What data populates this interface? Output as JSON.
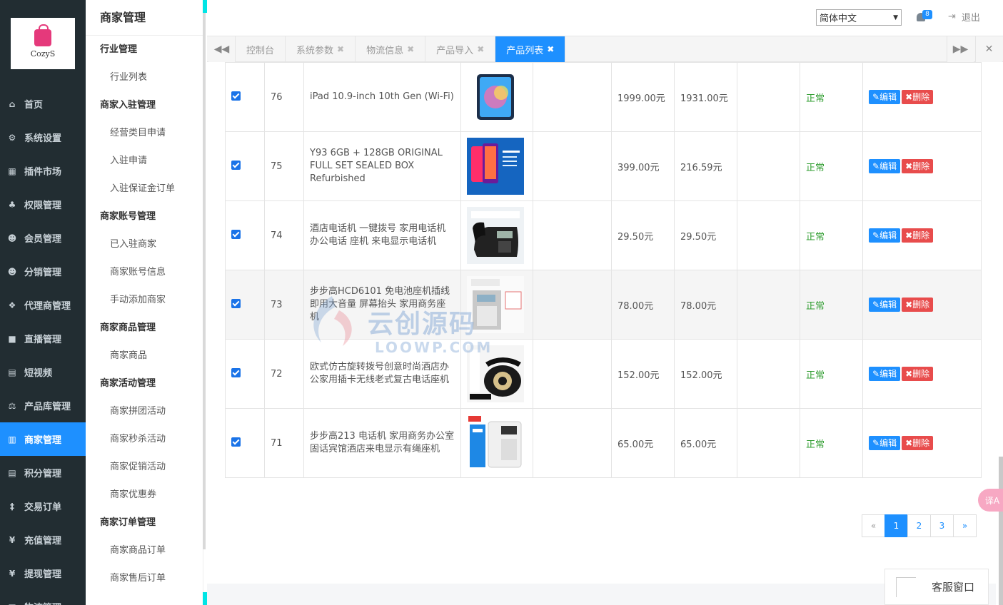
{
  "brand": {
    "logo_text": "CozyS"
  },
  "main_menu": [
    {
      "label": "首页",
      "icon": "home-icon",
      "glyph": "⌂"
    },
    {
      "label": "系统设置",
      "icon": "gear-icon",
      "glyph": "⚙"
    },
    {
      "label": "插件市场",
      "icon": "plugin-icon",
      "glyph": "▦"
    },
    {
      "label": "权限管理",
      "icon": "sitemap-icon",
      "glyph": "♣"
    },
    {
      "label": "会员管理",
      "icon": "users-icon",
      "glyph": "☻"
    },
    {
      "label": "分销管理",
      "icon": "users-icon",
      "glyph": "☻"
    },
    {
      "label": "代理商管理",
      "icon": "cubes-icon",
      "glyph": "❖"
    },
    {
      "label": "直播管理",
      "icon": "video-icon",
      "glyph": "■"
    },
    {
      "label": "短视频",
      "icon": "file-icon",
      "glyph": "▤"
    },
    {
      "label": "产品库管理",
      "icon": "balance-scale-icon",
      "glyph": "⚖"
    },
    {
      "label": "商家管理",
      "icon": "bank-icon",
      "glyph": "▥",
      "active": true
    },
    {
      "label": "积分管理",
      "icon": "file-text-icon",
      "glyph": "▤"
    },
    {
      "label": "交易订单",
      "icon": "yen-icon",
      "glyph": "‡"
    },
    {
      "label": "充值管理",
      "icon": "yen-icon",
      "glyph": "¥"
    },
    {
      "label": "提现管理",
      "icon": "yen-icon",
      "glyph": "¥"
    },
    {
      "label": "物流管理",
      "icon": "truck-icon",
      "glyph": "▣"
    }
  ],
  "sub_nav": {
    "title": "商家管理",
    "groups": [
      {
        "title": "行业管理",
        "items": [
          "行业列表"
        ]
      },
      {
        "title": "商家入驻管理",
        "items": [
          "经营类目申请",
          "入驻申请",
          "入驻保证金订单"
        ]
      },
      {
        "title": "商家账号管理",
        "items": [
          "已入驻商家",
          "商家账号信息",
          "手动添加商家"
        ]
      },
      {
        "title": "商家商品管理",
        "items": [
          "商家商品"
        ]
      },
      {
        "title": "商家活动管理",
        "items": [
          "商家拼团活动",
          "商家秒杀活动",
          "商家促销活动",
          "商家优惠券"
        ]
      },
      {
        "title": "商家订单管理",
        "items": [
          "商家商品订单",
          "商家售后订单"
        ]
      }
    ]
  },
  "topbar": {
    "language": "简体中文",
    "notification_count": "8",
    "logout_label": "退出"
  },
  "tabs": [
    {
      "label": "控制台",
      "closable": false
    },
    {
      "label": "系统参数",
      "closable": true
    },
    {
      "label": "物流信息",
      "closable": true
    },
    {
      "label": "产品导入",
      "closable": true
    },
    {
      "label": "产品列表",
      "closable": true,
      "active": true
    }
  ],
  "table": {
    "rows": [
      {
        "id": "76",
        "name": "iPad 10.9-inch 10th Gen (Wi-Fi)",
        "price": "1999.00元",
        "cost": "1931.00元",
        "status": "正常",
        "thumb": "ipad"
      },
      {
        "id": "75",
        "name": "Y93 6GB + 128GB ORIGINAL FULL SET SEALED BOX Refurbished",
        "price": "399.00元",
        "cost": "216.59元",
        "status": "正常",
        "thumb": "phone"
      },
      {
        "id": "74",
        "name": "酒店电话机 一键拨号 家用电话机 办公电话 座机 来电显示电话机",
        "price": "29.50元",
        "cost": "29.50元",
        "status": "正常",
        "thumb": "deskphone-black"
      },
      {
        "id": "73",
        "name": "步步高HCD6101 免电池座机插线 即用大音量 屏幕抬头 家用商务座机",
        "price": "78.00元",
        "cost": "78.00元",
        "status": "正常",
        "thumb": "deskphone-gray",
        "highlight": true
      },
      {
        "id": "72",
        "name": "欧式仿古旋转拨号创意时尚酒店办公家用插卡无线老式复古电话座机",
        "price": "152.00元",
        "cost": "152.00元",
        "status": "正常",
        "thumb": "retro-phone"
      },
      {
        "id": "71",
        "name": "步步高213 电话机 家用商务办公室 固话宾馆酒店来电显示有绳座机",
        "price": "65.00元",
        "cost": "65.00元",
        "status": "正常",
        "thumb": "deskphone-white"
      }
    ],
    "edit_label": "编辑",
    "delete_label": "删除"
  },
  "pagination": {
    "prev": "«",
    "pages": [
      "1",
      "2",
      "3"
    ],
    "current": "1",
    "next": "»"
  },
  "watermark": {
    "text": "云创源码",
    "sub": "LOOWP.COM"
  },
  "translate_label": "译A",
  "service_window_label": "客服窗口",
  "colors": {
    "sidebar_bg": "#222d32",
    "accent": "#1e90ff",
    "danger": "#e84c4c",
    "status_ok": "#2e9c2e"
  }
}
